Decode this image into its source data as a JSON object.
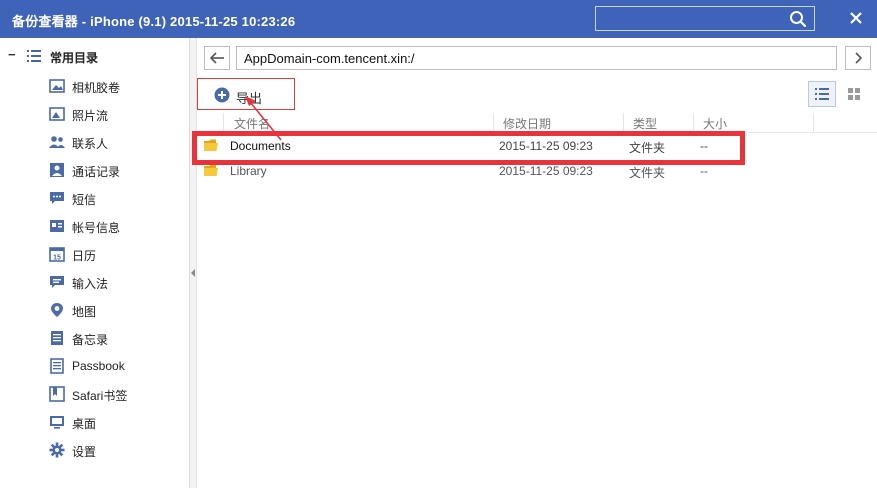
{
  "titlebar": {
    "title": "备份查看器 - iPhone (9.1) 2015-11-25 10:23:26",
    "search_placeholder": "",
    "close_label": "×"
  },
  "sidebar": {
    "group_label": "常用目录",
    "collapse_symbol": "−",
    "items": [
      {
        "label": "相机胶卷",
        "icon": "photo-icon"
      },
      {
        "label": "照片流",
        "icon": "photo-stream-icon"
      },
      {
        "label": "联系人",
        "icon": "contacts-icon"
      },
      {
        "label": "通话记录",
        "icon": "call-log-icon"
      },
      {
        "label": "短信",
        "icon": "sms-icon"
      },
      {
        "label": "帐号信息",
        "icon": "account-icon"
      },
      {
        "label": "日历",
        "icon": "calendar-icon"
      },
      {
        "label": "输入法",
        "icon": "keyboard-icon"
      },
      {
        "label": "地图",
        "icon": "map-pin-icon"
      },
      {
        "label": "备忘录",
        "icon": "notes-icon"
      },
      {
        "label": "Passbook",
        "icon": "passbook-icon"
      },
      {
        "label": "Safari书签",
        "icon": "bookmark-icon"
      },
      {
        "label": "桌面",
        "icon": "desktop-icon"
      },
      {
        "label": "设置",
        "icon": "gear-icon"
      }
    ]
  },
  "address": {
    "path": "AppDomain-com.tencent.xin:/"
  },
  "toolbar": {
    "export_label": "导出"
  },
  "table": {
    "headers": [
      "文件名",
      "修改日期",
      "类型",
      "大小"
    ],
    "rows": [
      {
        "name": "Documents",
        "date": "2015-11-25 09:23",
        "type": "文件夹",
        "size": "--"
      },
      {
        "name": "Library",
        "date": "2015-11-25 09:23",
        "type": "文件夹",
        "size": "--"
      }
    ]
  },
  "colors": {
    "titlebar": "#3f63b9",
    "annotation": "#e8333a",
    "folder": "#f2c12e"
  }
}
